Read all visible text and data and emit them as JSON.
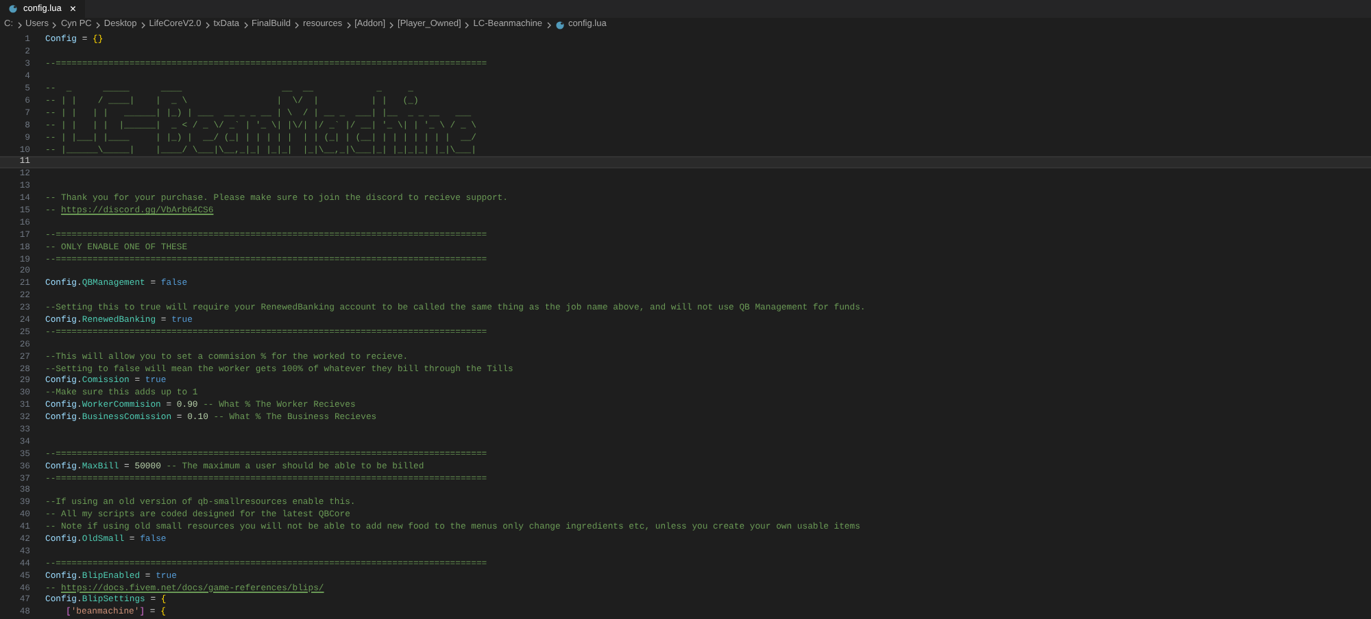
{
  "tab": {
    "label": "config.lua",
    "close": "×",
    "selected": true
  },
  "breadcrumbs": [
    "C:",
    "Users",
    "Cyn PC",
    "Desktop",
    "LifeCoreV2.0",
    "txData",
    "FinalBuild",
    "resources",
    "[Addon]",
    "[Player_Owned]",
    "LC-Beanmachine",
    "config.lua"
  ],
  "lines": [
    {
      "number": "1",
      "current": false,
      "tokens": [
        {
          "kind": "var",
          "text": "Config"
        },
        {
          "kind": "op",
          "text": " = "
        },
        {
          "kind": "brace",
          "text": "{}"
        }
      ]
    },
    {
      "number": "2",
      "current": false
    },
    {
      "number": "3",
      "current": false,
      "tokens": [
        {
          "kind": "comment",
          "text": "--=================================================================================="
        }
      ]
    },
    {
      "number": "4",
      "current": false
    },
    {
      "number": "5",
      "current": false,
      "tokens": [
        {
          "kind": "comment",
          "text": "--  _      _____      ____                   __  __            _     _"
        }
      ]
    },
    {
      "number": "6",
      "current": false,
      "tokens": [
        {
          "kind": "comment",
          "text": "-- | |    / ____|    |  _ \\                 |  \\/  |          | |   (_)"
        }
      ]
    },
    {
      "number": "7",
      "current": false,
      "tokens": [
        {
          "kind": "comment",
          "text": "-- | |   | |   ______| |_) | ___  __ _ _ __ | \\  / | __ _  ___| |__  _ _ __   ___"
        }
      ]
    },
    {
      "number": "8",
      "current": false,
      "tokens": [
        {
          "kind": "comment",
          "text": "-- | |   | |  |______|  _ < / _ \\/ _` | '_ \\| |\\/| |/ _` |/ __| '_ \\| | '_ \\ / _ \\"
        }
      ]
    },
    {
      "number": "9",
      "current": false,
      "tokens": [
        {
          "kind": "comment",
          "text": "-- | |___| |____     | |_) |  __/ (_| | | | | |  | | (_| | (__| | | | | | | |  __/"
        }
      ]
    },
    {
      "number": "10",
      "current": false,
      "tokens": [
        {
          "kind": "comment",
          "text": "-- |______\\_____|    |____/ \\___|\\__,_|_| |_|_|  |_|\\__,_|\\___|_| |_|_|_| |_|\\___|"
        }
      ]
    },
    {
      "number": "11",
      "current": true
    },
    {
      "number": "12",
      "current": false
    },
    {
      "number": "13",
      "current": false
    },
    {
      "number": "14",
      "current": false,
      "tokens": [
        {
          "kind": "comment",
          "text": "-- Thank you for your purchase. Please make sure to join the discord to recieve support."
        }
      ]
    },
    {
      "number": "15",
      "current": false,
      "tokens": [
        {
          "kind": "comment",
          "text": "-- "
        },
        {
          "kind": "link",
          "text": "https://discord.gg/VbArb64CS6"
        }
      ]
    },
    {
      "number": "16",
      "current": false
    },
    {
      "number": "17",
      "current": false,
      "tokens": [
        {
          "kind": "comment",
          "text": "--=================================================================================="
        }
      ]
    },
    {
      "number": "18",
      "current": false,
      "tokens": [
        {
          "kind": "comment",
          "text": "-- ONLY ENABLE ONE OF THESE"
        }
      ]
    },
    {
      "number": "19",
      "current": false,
      "tokens": [
        {
          "kind": "comment",
          "text": "--=================================================================================="
        }
      ]
    },
    {
      "number": "20",
      "current": false
    },
    {
      "number": "21",
      "current": false,
      "tokens": [
        {
          "kind": "var",
          "text": "Config"
        },
        {
          "kind": "op",
          "text": "."
        },
        {
          "kind": "field",
          "text": "QBManagement"
        },
        {
          "kind": "op",
          "text": " = "
        },
        {
          "kind": "bool",
          "text": "false"
        }
      ]
    },
    {
      "number": "22",
      "current": false
    },
    {
      "number": "23",
      "current": false,
      "tokens": [
        {
          "kind": "comment",
          "text": "--Setting this to true will require your RenewedBanking account to be called the same thing as the job name above, and will not use QB Management for funds."
        }
      ]
    },
    {
      "number": "24",
      "current": false,
      "tokens": [
        {
          "kind": "var",
          "text": "Config"
        },
        {
          "kind": "op",
          "text": "."
        },
        {
          "kind": "field",
          "text": "RenewedBanking"
        },
        {
          "kind": "op",
          "text": " = "
        },
        {
          "kind": "bool",
          "text": "true"
        }
      ]
    },
    {
      "number": "25",
      "current": false,
      "tokens": [
        {
          "kind": "comment",
          "text": "--=================================================================================="
        }
      ]
    },
    {
      "number": "26",
      "current": false
    },
    {
      "number": "27",
      "current": false,
      "tokens": [
        {
          "kind": "comment",
          "text": "--This will allow you to set a commision % for the worked to recieve."
        }
      ]
    },
    {
      "number": "28",
      "current": false,
      "tokens": [
        {
          "kind": "comment",
          "text": "--Setting to false will mean the worker gets 100% of whatever they bill through the Tills"
        }
      ]
    },
    {
      "number": "29",
      "current": false,
      "tokens": [
        {
          "kind": "var",
          "text": "Config"
        },
        {
          "kind": "op",
          "text": "."
        },
        {
          "kind": "field",
          "text": "Comission"
        },
        {
          "kind": "op",
          "text": " = "
        },
        {
          "kind": "bool",
          "text": "true"
        }
      ]
    },
    {
      "number": "30",
      "current": false,
      "tokens": [
        {
          "kind": "comment",
          "text": "--Make sure this adds up to 1"
        }
      ]
    },
    {
      "number": "31",
      "current": false,
      "tokens": [
        {
          "kind": "var",
          "text": "Config"
        },
        {
          "kind": "op",
          "text": "."
        },
        {
          "kind": "field",
          "text": "WorkerCommision"
        },
        {
          "kind": "op",
          "text": " = "
        },
        {
          "kind": "num",
          "text": "0.90"
        },
        {
          "kind": "comment",
          "text": " -- What % The Worker Recieves"
        }
      ]
    },
    {
      "number": "32",
      "current": false,
      "tokens": [
        {
          "kind": "var",
          "text": "Config"
        },
        {
          "kind": "op",
          "text": "."
        },
        {
          "kind": "field",
          "text": "BusinessComission"
        },
        {
          "kind": "op",
          "text": " = "
        },
        {
          "kind": "num",
          "text": "0.10"
        },
        {
          "kind": "comment",
          "text": " -- What % The Business Recieves"
        }
      ]
    },
    {
      "number": "33",
      "current": false
    },
    {
      "number": "34",
      "current": false
    },
    {
      "number": "35",
      "current": false,
      "tokens": [
        {
          "kind": "comment",
          "text": "--=================================================================================="
        }
      ]
    },
    {
      "number": "36",
      "current": false,
      "tokens": [
        {
          "kind": "var",
          "text": "Config"
        },
        {
          "kind": "op",
          "text": "."
        },
        {
          "kind": "field",
          "text": "MaxBill"
        },
        {
          "kind": "op",
          "text": " = "
        },
        {
          "kind": "num",
          "text": "50000"
        },
        {
          "kind": "comment",
          "text": " -- The maximum a user should be able to be billed"
        }
      ]
    },
    {
      "number": "37",
      "current": false,
      "tokens": [
        {
          "kind": "comment",
          "text": "--=================================================================================="
        }
      ]
    },
    {
      "number": "38",
      "current": false
    },
    {
      "number": "39",
      "current": false,
      "tokens": [
        {
          "kind": "comment",
          "text": "--If using an old version of qb-smallresources enable this."
        }
      ]
    },
    {
      "number": "40",
      "current": false,
      "tokens": [
        {
          "kind": "comment",
          "text": "-- All my scripts are coded designed for the latest QBCore"
        }
      ]
    },
    {
      "number": "41",
      "current": false,
      "tokens": [
        {
          "kind": "comment",
          "text": "-- Note if using old small resources you will not be able to add new food to the menus only change ingredients etc, unless you create your own usable items"
        }
      ]
    },
    {
      "number": "42",
      "current": false,
      "tokens": [
        {
          "kind": "var",
          "text": "Config"
        },
        {
          "kind": "op",
          "text": "."
        },
        {
          "kind": "field",
          "text": "OldSmall"
        },
        {
          "kind": "op",
          "text": " = "
        },
        {
          "kind": "bool",
          "text": "false"
        }
      ]
    },
    {
      "number": "43",
      "current": false
    },
    {
      "number": "44",
      "current": false,
      "tokens": [
        {
          "kind": "comment",
          "text": "--=================================================================================="
        }
      ]
    },
    {
      "number": "45",
      "current": false,
      "tokens": [
        {
          "kind": "var",
          "text": "Config"
        },
        {
          "kind": "op",
          "text": "."
        },
        {
          "kind": "field",
          "text": "BlipEnabled"
        },
        {
          "kind": "op",
          "text": " = "
        },
        {
          "kind": "bool",
          "text": "true"
        }
      ]
    },
    {
      "number": "46",
      "current": false,
      "tokens": [
        {
          "kind": "comment",
          "text": "-- "
        },
        {
          "kind": "link",
          "text": "https://docs.fivem.net/docs/game-references/blips/"
        }
      ]
    },
    {
      "number": "47",
      "current": false,
      "tokens": [
        {
          "kind": "var",
          "text": "Config"
        },
        {
          "kind": "op",
          "text": "."
        },
        {
          "kind": "field",
          "text": "BlipSettings"
        },
        {
          "kind": "op",
          "text": " = "
        },
        {
          "kind": "brace",
          "text": "{"
        }
      ]
    },
    {
      "number": "48",
      "current": false,
      "indented": true,
      "tokens": [
        {
          "kind": "bracket",
          "text": "["
        },
        {
          "kind": "str",
          "text": "'beanmachine'"
        },
        {
          "kind": "bracket",
          "text": "]"
        },
        {
          "kind": "op",
          "text": " = "
        },
        {
          "kind": "brace",
          "text": "{"
        }
      ]
    }
  ]
}
